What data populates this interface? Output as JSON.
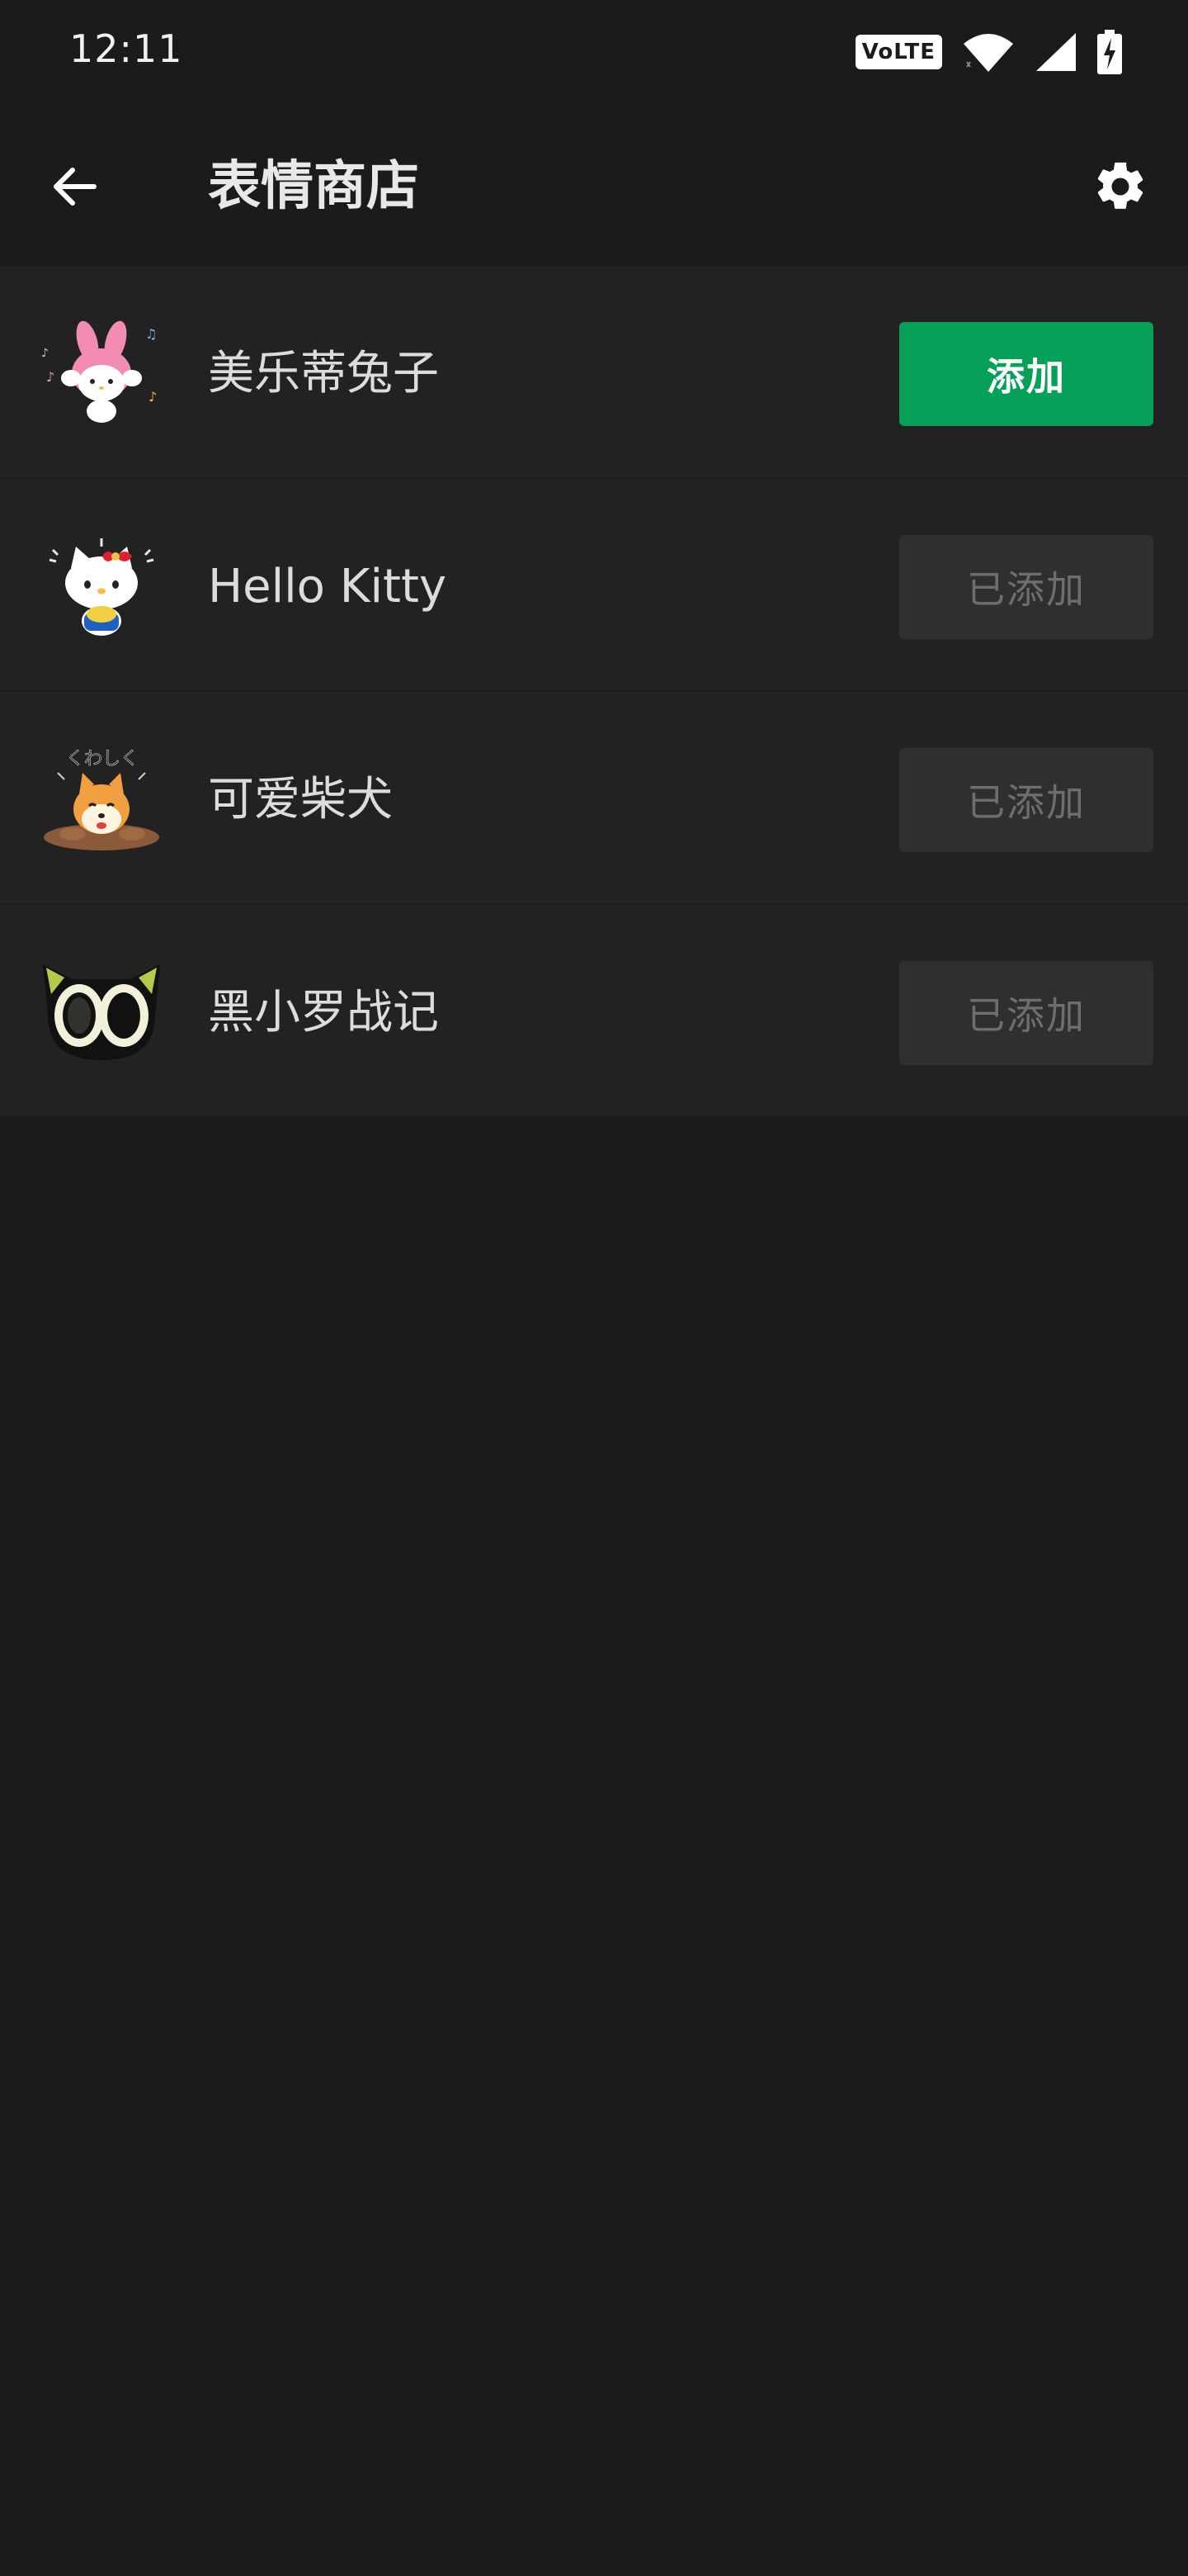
{
  "status_bar": {
    "time": "12:11",
    "volte": "VoLTE",
    "icons": [
      "volte-icon",
      "wifi-icon",
      "cell-signal-icon",
      "battery-charging-icon"
    ]
  },
  "app_bar": {
    "title": "表情商店",
    "back_icon": "arrow-left-icon",
    "settings_icon": "gear-icon"
  },
  "stickers": [
    {
      "name": "美乐蒂兔子",
      "button_label": "添加",
      "added": false,
      "thumb": "my-melody-icon"
    },
    {
      "name": "Hello Kitty",
      "button_label": "已添加",
      "added": true,
      "thumb": "hello-kitty-icon"
    },
    {
      "name": "可爱柴犬",
      "button_label": "已添加",
      "added": true,
      "thumb": "shiba-dog-icon"
    },
    {
      "name": "黑小罗战记",
      "button_label": "已添加",
      "added": true,
      "thumb": "black-cat-icon"
    }
  ],
  "colors": {
    "background": "#1a1a1a",
    "item_background": "#222222",
    "add_button": "#07a059",
    "added_button": "#2f2f2f"
  }
}
